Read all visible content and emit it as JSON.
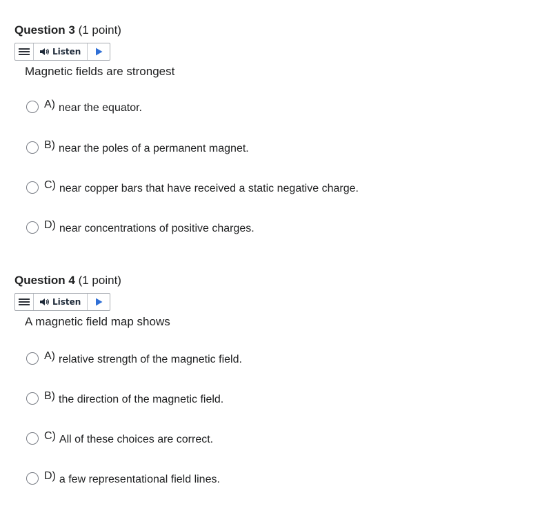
{
  "questions": [
    {
      "name": "Question 3",
      "points": "(1 point)",
      "listen_label": "Listen",
      "prompt": "Magnetic fields are strongest",
      "options": [
        {
          "letter": "A)",
          "text": "near the equator."
        },
        {
          "letter": "B)",
          "text": "near the poles of a permanent magnet."
        },
        {
          "letter": "C)",
          "text": "near copper bars that have received a static negative charge."
        },
        {
          "letter": "D)",
          "text": "near concentrations of positive charges."
        }
      ]
    },
    {
      "name": "Question 4",
      "points": "(1 point)",
      "listen_label": "Listen",
      "prompt": "A magnetic field map shows",
      "options": [
        {
          "letter": "A)",
          "text": "relative strength of the magnetic field."
        },
        {
          "letter": "B)",
          "text": "the direction of the magnetic field."
        },
        {
          "letter": "C)",
          "text": "All of these choices are correct."
        },
        {
          "letter": "D)",
          "text": "a few representational field lines."
        }
      ]
    }
  ],
  "colors": {
    "text": "#202122",
    "border": "#a6aab0",
    "play": "#2f6fd6"
  },
  "icons": {
    "menu": "menu-icon",
    "speaker": "speaker-icon",
    "play": "play-icon"
  }
}
